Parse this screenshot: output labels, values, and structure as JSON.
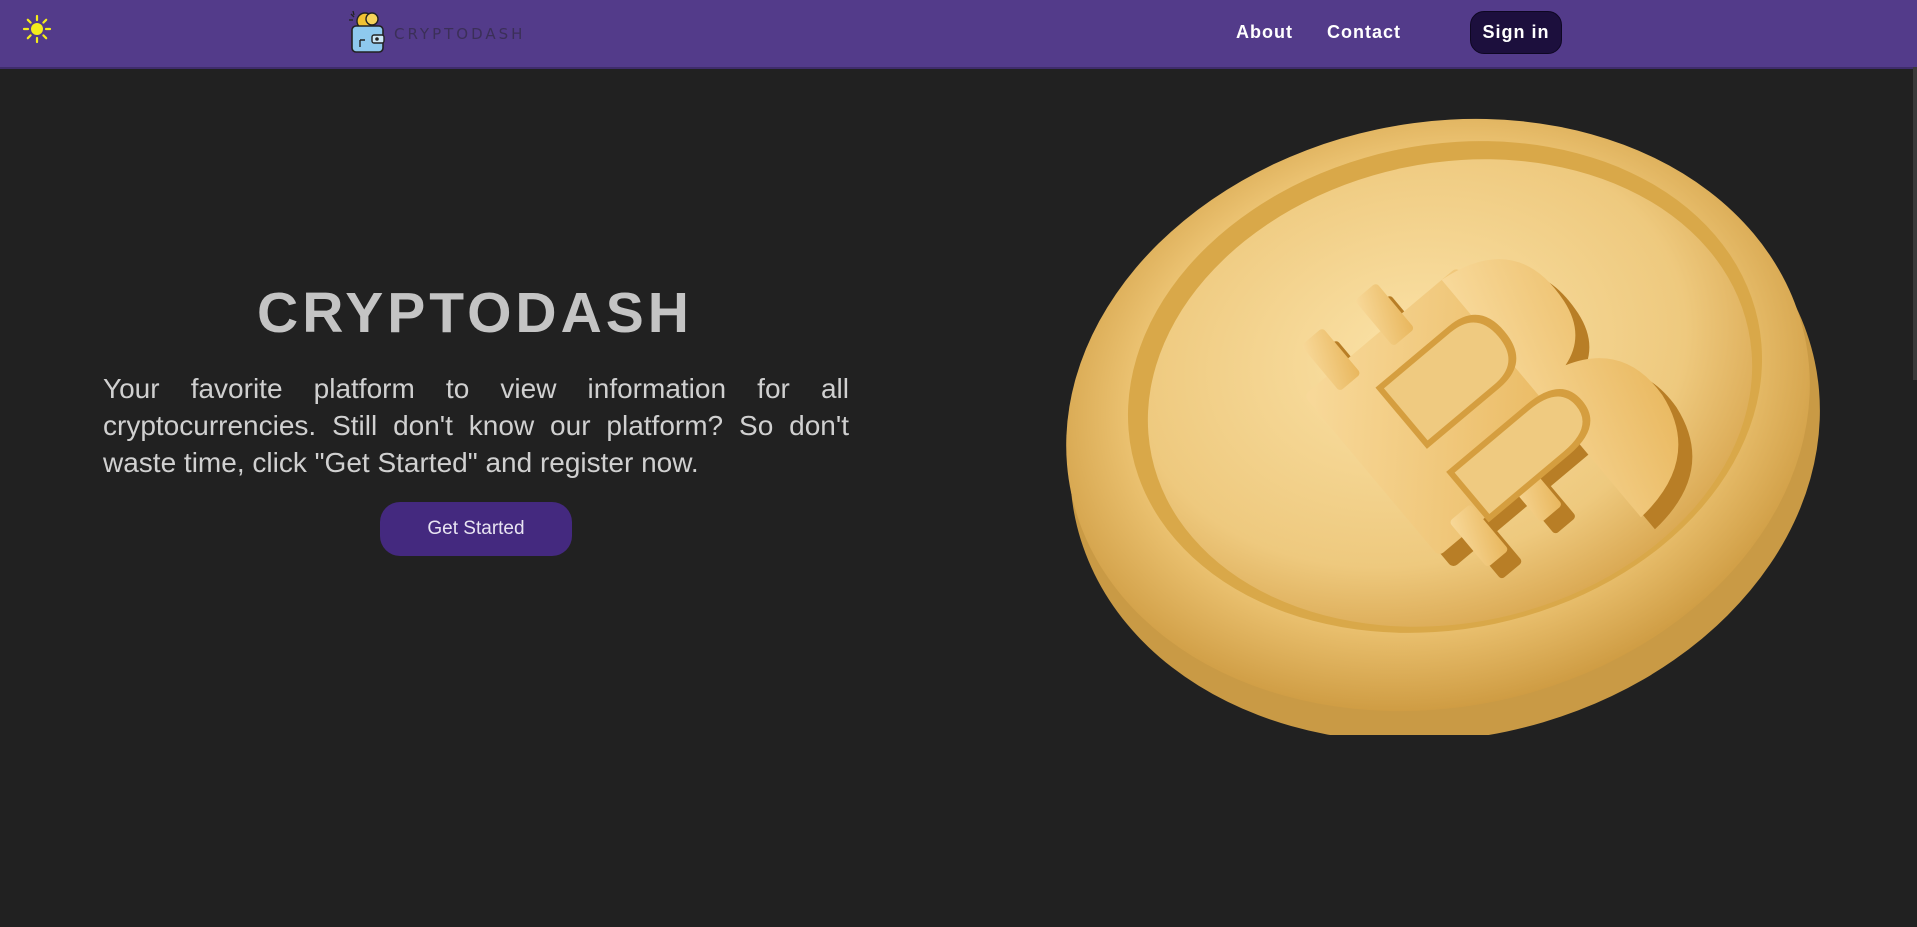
{
  "header": {
    "theme_icon": "sun-icon",
    "logo_text": "CRYPTODASH",
    "nav": [
      {
        "label": "About"
      },
      {
        "label": "Contact"
      }
    ],
    "signin_label": "Sign in"
  },
  "hero": {
    "title": "CRYPTODASH",
    "description": "Your favorite platform to view information for all cryptocurrencies. Still don't know our platform? So don't waste time, click \"Get Started\" and register now.",
    "cta_label": "Get Started",
    "image_icon": "bitcoin-coin-icon"
  },
  "colors": {
    "navbar": "#533b8a",
    "background": "#212121",
    "cta": "#44297f",
    "signin": "#1c0f3d",
    "coin_gold": "#e9bd5c"
  }
}
